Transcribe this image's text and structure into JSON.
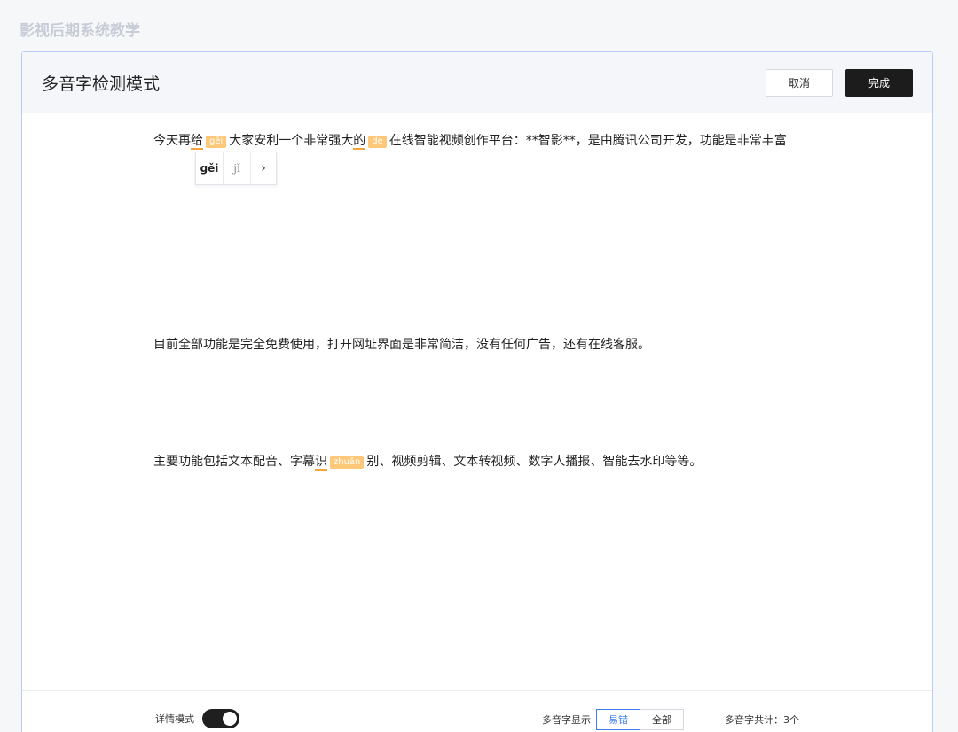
{
  "app_title": "影视后期系统教学",
  "dialog": {
    "title": "多音字检测模式",
    "cancel_label": "取消",
    "done_label": "完成"
  },
  "paragraphs": [
    {
      "seg1": "今天再",
      "poly1": "给",
      "tag1": "gěi",
      "seg2": "大家安利一个非常强大",
      "poly2": "的",
      "tag2": "de",
      "seg3": "在线智能视频创作平台：**智影**，是由腾讯公司开发，功能是非常丰富"
    },
    {
      "text": "目前全部功能是完全免费使用，打开网址界面是非常简洁，没有任何广告，还有在线客服。"
    },
    {
      "seg1": "主要功能包括文本配音、字幕",
      "poly1": "识",
      "tag1": "zhuǎn",
      "seg2": "别、视频剪辑、文本转视频、数字人播报、智能去水印等等。"
    }
  ],
  "popup": {
    "options": [
      "gěi",
      "jǐ"
    ],
    "more_icon": "chevron-right-icon"
  },
  "footer": {
    "detail_mode_label": "详情模式",
    "detail_mode_on": true,
    "display_label": "多音字显示",
    "display_options": [
      "易错",
      "全部"
    ],
    "display_selected": "易错",
    "count_text": "多音字共计：3个"
  },
  "colors": {
    "accent": "#3d7cf0",
    "tag_bg": "#ffc879",
    "underline": "#f4a53c",
    "primary_btn": "#1c1c1c"
  }
}
